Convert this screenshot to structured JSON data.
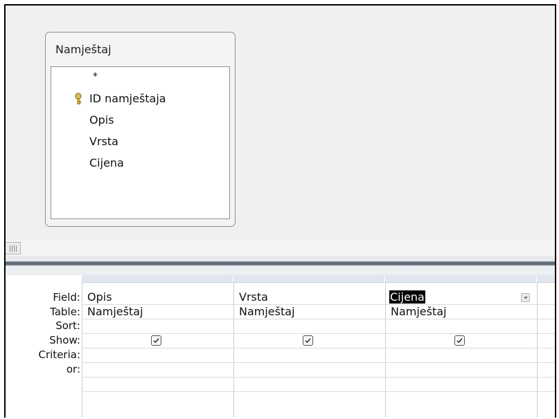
{
  "table": {
    "title": "Namještaj",
    "fields": [
      "*",
      "ID namještaja",
      "Opis",
      "Vrsta",
      "Cijena"
    ]
  },
  "grid": {
    "row_labels": {
      "field": "Field:",
      "table": "Table:",
      "sort": "Sort:",
      "show": "Show:",
      "criteria": "Criteria:",
      "or": "or:"
    },
    "columns": [
      {
        "field": "Opis",
        "table": "Namještaj",
        "sort": "",
        "show": true
      },
      {
        "field": "Vrsta",
        "table": "Namještaj",
        "sort": "",
        "show": true
      },
      {
        "field": "Cijena",
        "table": "Namještaj",
        "sort": "",
        "show": true
      }
    ]
  }
}
